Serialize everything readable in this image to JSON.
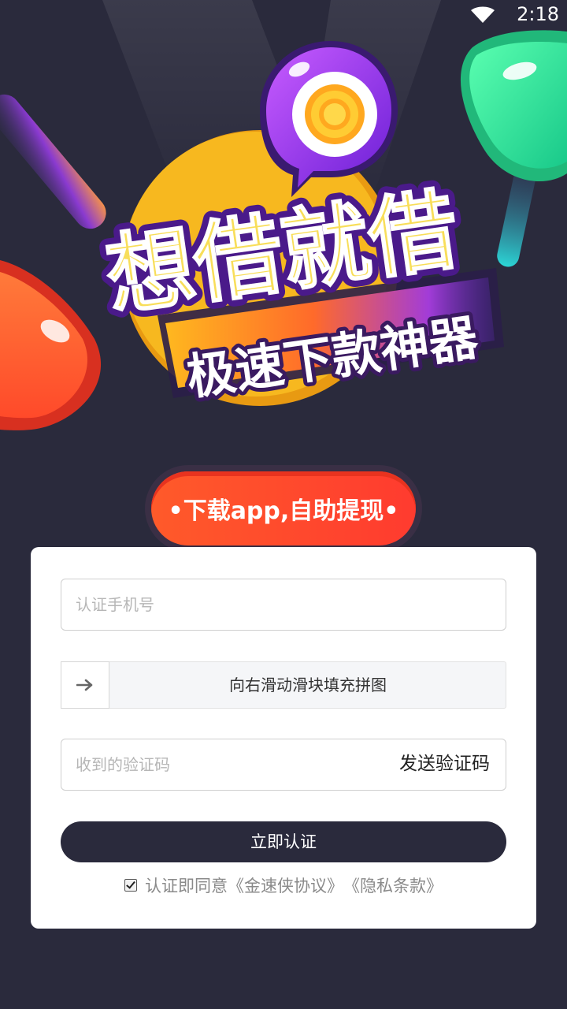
{
  "status_bar": {
    "time": "2:18"
  },
  "hero": {
    "title": "想借就借",
    "subtitle": "极速下款神器",
    "colors": {
      "yellow": "#f7b81f",
      "purple": "#8a2be2",
      "orange": "#ff6a2a",
      "green": "#3ef0a0"
    }
  },
  "download_pill": {
    "text": "•下载app,自助提现•"
  },
  "form": {
    "phone_placeholder": "认证手机号",
    "slider_text": "向右滑动滑块填充拼图",
    "code_placeholder": "收到的验证码",
    "send_code_label": "发送验证码",
    "submit_label": "立即认证",
    "agree_prefix": "认证即同意",
    "agree_link_1": "《金速侠协议》",
    "agree_link_2": "《隐私条款》"
  },
  "colors": {
    "background": "#2a2a3c",
    "card": "#ffffff",
    "button": "#2a2a3c",
    "accent_red": "#ff4a2a"
  }
}
